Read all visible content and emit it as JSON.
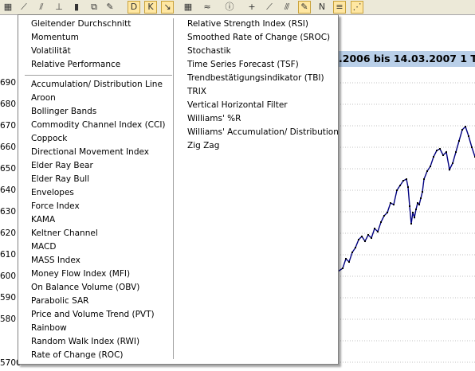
{
  "toolbar": {
    "buttons": [
      {
        "icon": "candlestick-icon",
        "glyph": "▦"
      },
      {
        "icon": "line-chart-icon",
        "glyph": "⟋"
      },
      {
        "icon": "multi-line-chart-icon",
        "glyph": "⫽"
      },
      {
        "icon": "ohlc-chart-icon",
        "glyph": "⊥"
      },
      {
        "icon": "volume-bars-icon",
        "glyph": "▮"
      },
      {
        "icon": "compare-chart-icon",
        "glyph": "⧉"
      },
      {
        "icon": "draw-line-icon",
        "glyph": "✎"
      },
      {
        "icon": "daily-icon",
        "glyph": "D"
      },
      {
        "icon": "candle-type-icon",
        "glyph": "K"
      },
      {
        "icon": "indicator-icon",
        "glyph": "↘"
      },
      {
        "icon": "grid-icon",
        "glyph": "▦"
      },
      {
        "icon": "zigzag-icon",
        "glyph": "≈"
      },
      {
        "icon": "info-icon",
        "glyph": "ⓘ"
      },
      {
        "icon": "crosshair-icon",
        "glyph": "+"
      },
      {
        "icon": "trend-icon",
        "glyph": "⟋"
      },
      {
        "icon": "channel-icon",
        "glyph": "⫻"
      },
      {
        "icon": "pencil-icon",
        "glyph": "✎"
      },
      {
        "icon": "news-icon",
        "glyph": "N"
      },
      {
        "icon": "fibonacci-icon",
        "glyph": "≡"
      },
      {
        "icon": "fan-icon",
        "glyph": "⋰"
      }
    ]
  },
  "chart": {
    "title_fragment": ".2006 bis 14.03.2007 1 T",
    "y_ticks": [
      "690",
      "680",
      "670",
      "660",
      "650",
      "640",
      "630",
      "620",
      "610",
      "600",
      "590",
      "580",
      "5700"
    ],
    "line_color": "#000080",
    "grid_color": "#c0c0c0",
    "header_bg": "#b9cfe8"
  },
  "menu": {
    "column1_top": [
      "Gleitender Durchschnitt",
      "Momentum",
      "Volatilität",
      "Relative Performance"
    ],
    "column1_bottom": [
      "Accumulation/ Distribution Line",
      "Aroon",
      "Bollinger Bands",
      "Commodity Channel Index (CCI)",
      "Coppock",
      "Directional Movement Index",
      "Elder Ray Bear",
      "Elder Ray Bull",
      "Envelopes",
      "Force Index",
      "KAMA",
      "Keltner Channel",
      "MACD",
      "MASS Index",
      "Money Flow Index (MFI)",
      "On Balance Volume (OBV)",
      "Parabolic SAR",
      "Price and Volume Trend (PVT)",
      "Rainbow",
      "Random Walk Index (RWI)",
      "Rate of Change (ROC)"
    ],
    "column2": [
      "Relative Strength Index (RSI)",
      "Smoothed Rate of Change (SROC)",
      "Stochastik",
      "Time Series Forecast (TSF)",
      "Trendbestätigungsindikator (TBI)",
      "TRIX",
      "Vertical Horizontal Filter",
      "Williams' %R",
      "Williams' Accumulation/ Distribution",
      "Zig Zag"
    ]
  }
}
